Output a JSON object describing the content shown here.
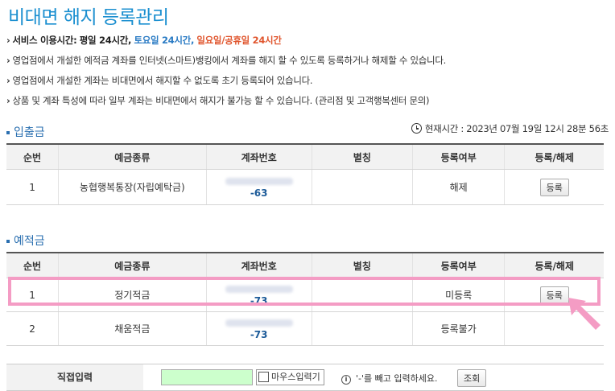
{
  "title": "비대면 해지 등록관리",
  "notices": {
    "hours": {
      "prefix": "서비스 이용시간:",
      "weekday": "평일 24시간,",
      "saturday": "토요일 24시간,",
      "sunday": "일요일/공휴일 24시간"
    },
    "line2": "영업점에서 개설한 예적금 계좌를 인터넷(스마트)뱅킹에서 계좌를 해지 할 수 있도록 등록하거나 해제할 수 있습니다.",
    "line3": "영업점에서 개설한 계좌는 비대면에서 해지할 수 없도록 초기 등록되어 있습니다.",
    "line4": "상품 및 계좌 특성에 따라 일부 계좌는 비대면에서 해지가 불가능 할 수 있습니다. (관리점 및 고객행복센터 문의)"
  },
  "current_time": "현재시간 : 2023년 07월 19일 12시 28분 56초",
  "columns": [
    "순번",
    "예금종류",
    "계좌번호",
    "별칭",
    "등록여부",
    "등록/해제"
  ],
  "deposit_section": {
    "title": "입출금",
    "rows": [
      {
        "no": "1",
        "type": "농협행복통장(자립예탁금)",
        "acct_suffix": "-63",
        "alias": "",
        "status": "해제",
        "action": "등록"
      }
    ]
  },
  "savings_section": {
    "title": "예적금",
    "rows": [
      {
        "no": "1",
        "type": "정기적금",
        "acct_suffix": "-73",
        "alias": "",
        "status": "미등록",
        "action": "등록"
      },
      {
        "no": "2",
        "type": "채움적금",
        "acct_suffix": "-73",
        "alias": "",
        "status": "등록불가",
        "action": ""
      }
    ]
  },
  "direct_input": {
    "label": "직접입력",
    "mouse_input": "마우스입력기",
    "hint": "'-'를 빼고 입력하세요.",
    "query_button": "조회"
  },
  "colors": {
    "title": "#1b8fd0",
    "highlight": "#f49cc4",
    "input_bg": "#ccffcc"
  }
}
